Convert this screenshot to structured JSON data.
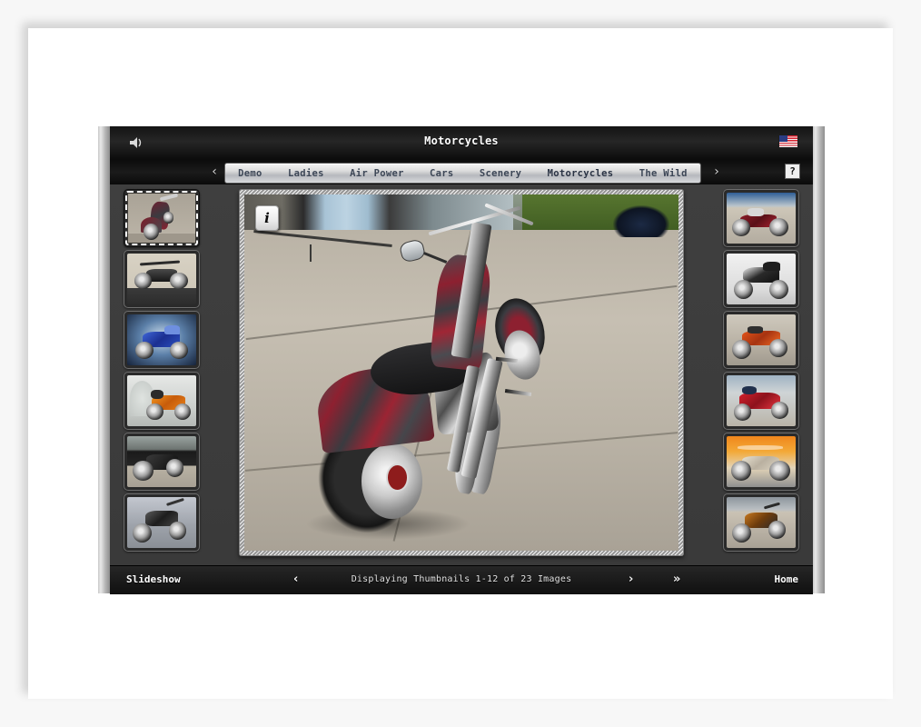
{
  "window": {
    "title": "Motorcycles",
    "speaker_icon": "speaker-icon",
    "flag_icon": "us-flag-icon",
    "help_label": "?"
  },
  "tabs": {
    "prev_arrow": "‹",
    "next_arrow": "›",
    "items": [
      {
        "label": "Demo",
        "active": false
      },
      {
        "label": "Ladies",
        "active": false
      },
      {
        "label": "Air Power",
        "active": false
      },
      {
        "label": "Cars",
        "active": false
      },
      {
        "label": "Scenery",
        "active": false
      },
      {
        "label": "Motorcycles",
        "active": true
      },
      {
        "label": "The Wild",
        "active": false
      }
    ]
  },
  "viewer": {
    "info_button_label": "i",
    "photo_description": "Custom chopper motorcycle with red and black flame paint, parked on a concrete lot"
  },
  "thumbnails_left": [
    {
      "name": "thumb-chopper-maroon-rear",
      "selected": true
    },
    {
      "name": "thumb-chopper-black-side",
      "selected": false
    },
    {
      "name": "thumb-sportbike-blue",
      "selected": false
    },
    {
      "name": "thumb-sportbike-orange",
      "selected": false
    },
    {
      "name": "thumb-chopper-black-garage",
      "selected": false
    },
    {
      "name": "thumb-chopper-silver",
      "selected": false
    }
  ],
  "thumbnails_right": [
    {
      "name": "thumb-chopper-red-shop",
      "selected": false
    },
    {
      "name": "thumb-sportbike-white",
      "selected": false
    },
    {
      "name": "thumb-chopper-orange",
      "selected": false
    },
    {
      "name": "thumb-sportbike-red",
      "selected": false
    },
    {
      "name": "thumb-chopper-flame-orange",
      "selected": false
    },
    {
      "name": "thumb-chopper-copper",
      "selected": false
    }
  ],
  "footer": {
    "slideshow_label": "Slideshow",
    "prev_arrow": "‹",
    "status": "Displaying Thumbnails 1-12 of 23 Images",
    "next_arrow": "›",
    "last_arrow": "»",
    "home_label": "Home"
  },
  "colors": {
    "window_bg": "#131313",
    "content_bg": "#3d3d3d",
    "rail": "#c8c8c8",
    "tab_text": "#3c4656",
    "text_light": "#ffffff"
  }
}
